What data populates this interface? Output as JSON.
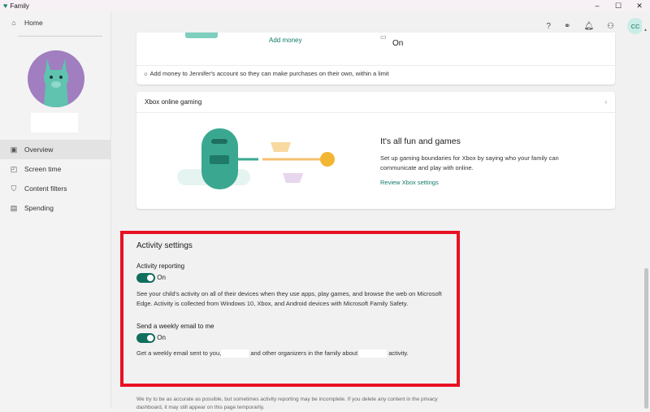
{
  "window": {
    "title": "Family",
    "controls": [
      "–",
      "☐",
      "✕"
    ]
  },
  "sidebar": {
    "home": "Home",
    "items": [
      {
        "label": "Overview",
        "icon": "overview-icon"
      },
      {
        "label": "Screen time",
        "icon": "screen-time-icon"
      },
      {
        "label": "Content filters",
        "icon": "shield-icon"
      },
      {
        "label": "Spending",
        "icon": "spending-icon"
      }
    ]
  },
  "header": {
    "avatar_initials": "CC"
  },
  "spending_card": {
    "add_money": "Add money",
    "status": "On",
    "tip": "Add money to Jennifer's account so they can make purchases on their own, within a limit"
  },
  "xbox_card": {
    "title": "Xbox online gaming",
    "heading": "It's all fun and games",
    "description": "Set up gaming boundaries for Xbox by saying who your family can communicate and play with online.",
    "link": "Review Xbox settings"
  },
  "activity": {
    "title": "Activity settings",
    "reporting_label": "Activity reporting",
    "reporting_state": "On",
    "reporting_desc": "See your child's activity on all of their devices when they use apps, play games, and browse the web on Microsoft Edge. Activity is collected from Windows 10, Xbox, and Android devices with Microsoft Family Safety.",
    "email_label": "Send a weekly email to me",
    "email_state": "On",
    "email_desc_1": "Get a weekly email sent to you,",
    "email_desc_2": "and other organizers in the family about",
    "email_desc_3": "activity."
  },
  "footer": {
    "text": "We try to be as accurate as possible, but sometimes activity reporting may be incomplete. If you delete any content in the privacy dashboard, it may still appear on this page temporarily."
  },
  "colors": {
    "accent": "#0f6e5d",
    "highlight": "#e81123"
  }
}
